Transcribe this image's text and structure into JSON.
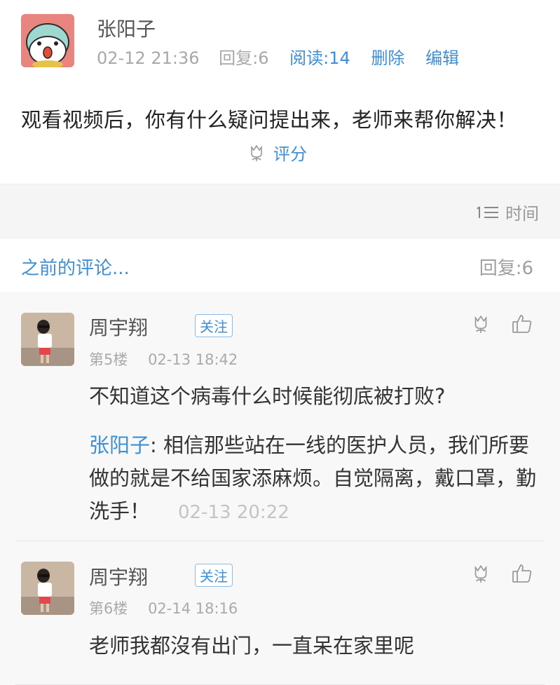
{
  "post": {
    "author": "张阳子",
    "date": "02-12 21:36",
    "reply_label": "回复:6",
    "read_label": "阅读:14",
    "delete_label": "删除",
    "edit_label": "编辑",
    "content": "观看视频后，你有什么疑问提出来，老师来帮你解决！",
    "rate_label": "评分",
    "colors": {
      "link": "#3f8fd4",
      "muted": "#a8a8a8"
    }
  },
  "sort": {
    "label": "时间",
    "icon": "sort-list-icon"
  },
  "previous": {
    "link_label": "之前的评论...",
    "reply_count": "回复:6"
  },
  "comments": [
    {
      "name": "周宇翔",
      "follow": "关注",
      "floor": "第5楼",
      "date": "02-13 18:42",
      "text": "不知道这个病毒什么时候能彻底被打败?",
      "reply": {
        "author": "张阳子",
        "text": ": 相信那些站在一线的医护人员，我们所要做的就是不给国家添麻烦。自觉隔离，戴口罩，勤洗手！",
        "time": "02-13 20:22"
      }
    },
    {
      "name": "周宇翔",
      "follow": "关注",
      "floor": "第6楼",
      "date": "02-14 18:16",
      "text": "老师我都沒有出门，一直呆在家里呢"
    }
  ]
}
